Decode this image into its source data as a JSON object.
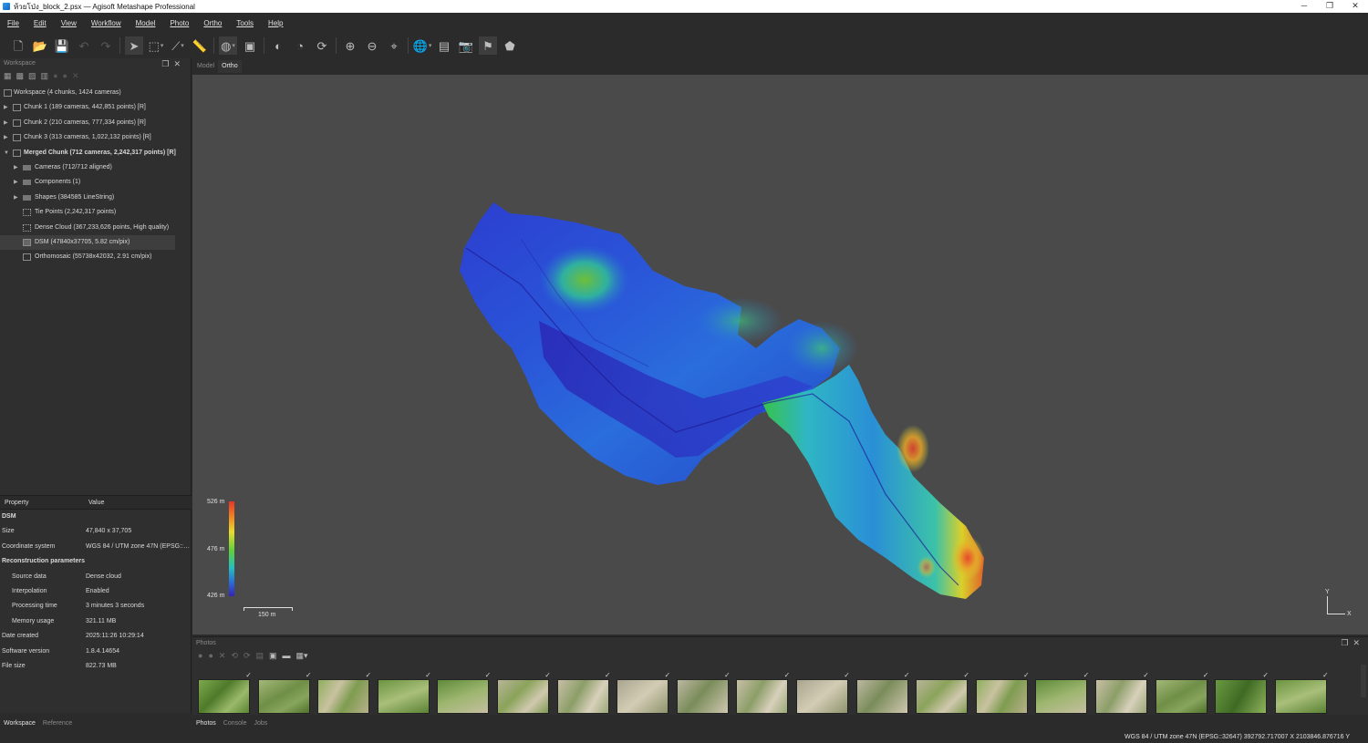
{
  "window": {
    "title": "ห้วยโป่ง_block_2.psx — Agisoft Metashape Professional"
  },
  "menu": [
    "File",
    "Edit",
    "View",
    "Workflow",
    "Model",
    "Photo",
    "Ortho",
    "Tools",
    "Help"
  ],
  "workspace": {
    "panel_title": "Workspace",
    "root": "Workspace (4 chunks, 1424 cameras)",
    "chunks": [
      "Chunk 1 (189 cameras, 442,851 points) [R]",
      "Chunk 2 (210 cameras, 777,334 points) [R]",
      "Chunk 3 (313 cameras, 1,022,132 points) [R]",
      "Merged Chunk (712 cameras, 2,242,317 points) [R]"
    ],
    "children": [
      "Cameras (712/712 aligned)",
      "Components (1)",
      "Shapes (384585 LineString)",
      "Tie Points (2,242,317 points)",
      "Dense Cloud (367,233,626 points, High quality)",
      "DSM (47840x37705, 5.82 cm/pix)",
      "Orthomosaic (55738x42032, 2.91 cm/pix)"
    ]
  },
  "properties": {
    "col_property": "Property",
    "col_value": "Value",
    "section": "DSM",
    "size_k": "Size",
    "size_v": "47,840 x 37,705",
    "cs_k": "Coordinate system",
    "cs_v": "WGS 84 / UTM zone 47N (EPSG::32647)",
    "recon": "Reconstruction parameters",
    "src_k": "Source data",
    "src_v": "Dense cloud",
    "interp_k": "Interpolation",
    "interp_v": "Enabled",
    "proc_k": "Processing time",
    "proc_v": "3 minutes 3 seconds",
    "mem_k": "Memory usage",
    "mem_v": "321.11 MB",
    "date_k": "Date created",
    "date_v": "2025:11:26 10:29:14",
    "ver_k": "Software version",
    "ver_v": "1.8.4.14654",
    "file_k": "File size",
    "file_v": "822.73 MB"
  },
  "left_tabs": [
    "Workspace",
    "Reference"
  ],
  "view_tabs": [
    "Model",
    "Ortho"
  ],
  "legend": {
    "max": "526 m",
    "mid": "476 m",
    "min": "426 m"
  },
  "scale_bar": "150 m",
  "axes": {
    "y": "Y",
    "x": "X"
  },
  "photos_panel": {
    "title": "Photos",
    "thumb_count": 19
  },
  "bottom_tabs": [
    "Photos",
    "Console",
    "Jobs"
  ],
  "status": "WGS 84 / UTM zone 47N (EPSG::32647)   392792.717007 X   2103846.876716 Y",
  "colors": {
    "background": "#2b2b2b",
    "viewport": "#4a4a4a",
    "dsm_low": "#3423b8",
    "dsm_high": "#e8362a"
  }
}
